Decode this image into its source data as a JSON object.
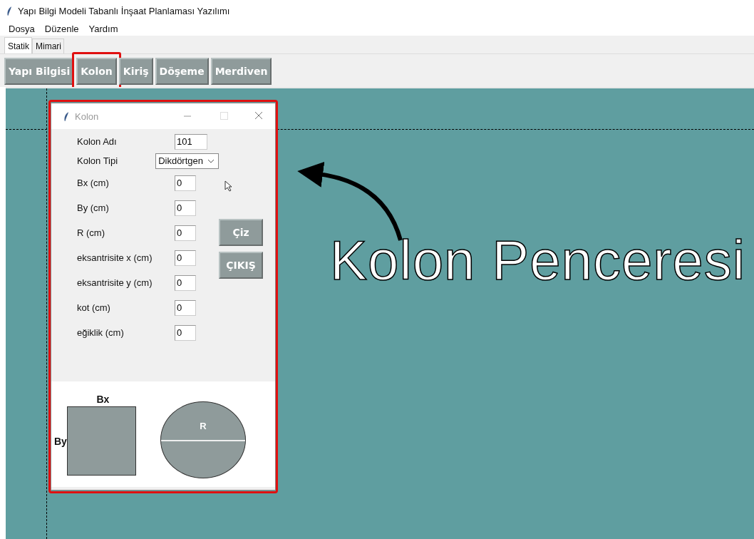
{
  "window": {
    "title": "Yapı Bilgi Modeli Tabanlı İnşaat Planlaması Yazılımı"
  },
  "menu": [
    "Dosya",
    "Düzenle",
    "Yardım"
  ],
  "tabs": [
    {
      "label": "Statik",
      "selected": true
    },
    {
      "label": "Mimari",
      "selected": false
    }
  ],
  "toolbar": [
    {
      "label": "Yapı Bilgisi",
      "highlighted": false
    },
    {
      "label": "Kolon",
      "highlighted": true
    },
    {
      "label": "Kiriş",
      "highlighted": false
    },
    {
      "label": "Döşeme",
      "highlighted": false
    },
    {
      "label": "Merdiven",
      "highlighted": false
    }
  ],
  "dialog": {
    "title": "Kolon",
    "highlighted": true,
    "fields": [
      {
        "kind": "entry",
        "label": "Kolon Adı",
        "value": "101"
      },
      {
        "kind": "dropdown",
        "label": "Kolon Tipi",
        "value": "Dikdörtgen"
      },
      {
        "kind": "entry",
        "label": "Bx  (cm)",
        "value": "0"
      },
      {
        "kind": "entry",
        "label": "By  (cm)",
        "value": "0"
      },
      {
        "kind": "entry",
        "label": "R  (cm)",
        "value": "0"
      },
      {
        "kind": "entry",
        "label": "eksantrisite x  (cm)",
        "value": "0"
      },
      {
        "kind": "entry",
        "label": "eksantrisite y  (cm)",
        "value": "0"
      },
      {
        "kind": "entry",
        "label": "kot  (cm)",
        "value": "0"
      },
      {
        "kind": "entry",
        "label": "eğiklik  (cm)",
        "value": "0"
      }
    ],
    "buttons": [
      "Çiz",
      "ÇIKIŞ"
    ],
    "diagram": {
      "rect_width_label": "Bx",
      "rect_height_label": "By",
      "circle_label": "R"
    }
  },
  "callout": "Kolon Penceresi"
}
